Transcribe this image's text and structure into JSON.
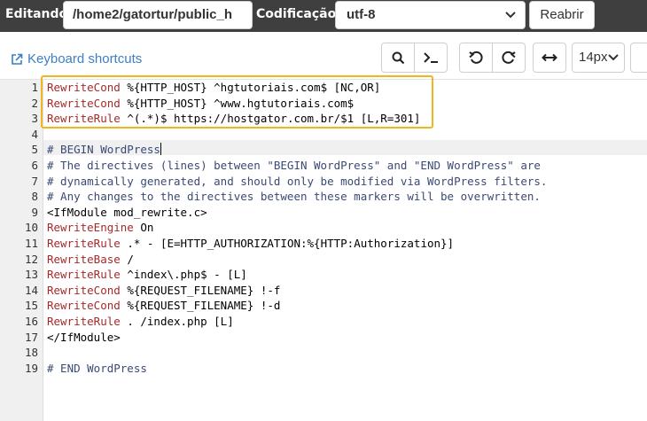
{
  "topbar": {
    "editing_label": "Editando:",
    "file_path": "/home2/gatortur/public_h",
    "encoding_label": "Codificação:",
    "encoding_value": "utf-8",
    "reopen_label": "Reabrir"
  },
  "toolbar": {
    "keyboard_shortcuts": "Keyboard shortcuts",
    "font_size": "14px"
  },
  "editor": {
    "line_numbers": [
      "1",
      "2",
      "3",
      "4",
      "5",
      "6",
      "7",
      "8",
      "9",
      "10",
      "11",
      "12",
      "13",
      "14",
      "15",
      "16",
      "17",
      "18",
      "19"
    ],
    "lines": [
      [
        "RewriteCond",
        " %{HTTP_HOST} ^hgtutoriais.com$ [NC,OR]"
      ],
      [
        "RewriteCond",
        " %{HTTP_HOST} ^www.hgtutoriais.com$"
      ],
      [
        "RewriteRule",
        " ^(.*)$ https://hostgator.com.br/$1 [L,R=301]"
      ],
      [
        "",
        ""
      ],
      [
        "",
        "# BEGIN WordPress"
      ],
      [
        "",
        "# The directives (lines) between \"BEGIN WordPress\" and \"END WordPress\" are"
      ],
      [
        "",
        "# dynamically generated, and should only be modified via WordPress filters."
      ],
      [
        "",
        "# Any changes to the directives between these markers will be overwritten."
      ],
      [
        "",
        "<IfModule mod_rewrite.c>"
      ],
      [
        "RewriteEngine",
        " On"
      ],
      [
        "RewriteRule",
        " .* - [E=HTTP_AUTHORIZATION:%{HTTP:Authorization}]"
      ],
      [
        "RewriteBase",
        " /"
      ],
      [
        "RewriteRule",
        " ^index\\.php$ - [L]"
      ],
      [
        "RewriteCond",
        " %{REQUEST_FILENAME} !-f"
      ],
      [
        "RewriteCond",
        " %{REQUEST_FILENAME} !-d"
      ],
      [
        "RewriteRule",
        " . /index.php [L]"
      ],
      [
        "",
        "</IfModule>"
      ],
      [
        "",
        ""
      ],
      [
        "",
        "# END WordPress"
      ]
    ],
    "active_line": 5
  },
  "colors": {
    "topbar_bg": "#3f3f3f",
    "highlight_border": "#f2b51d",
    "keyword": "#a52a2a",
    "link": "#3b7fc4"
  },
  "icons": [
    "external-link-icon",
    "search-icon",
    "terminal-icon",
    "undo-icon",
    "redo-icon",
    "wrap-arrows-icon",
    "chevron-down-icon"
  ]
}
